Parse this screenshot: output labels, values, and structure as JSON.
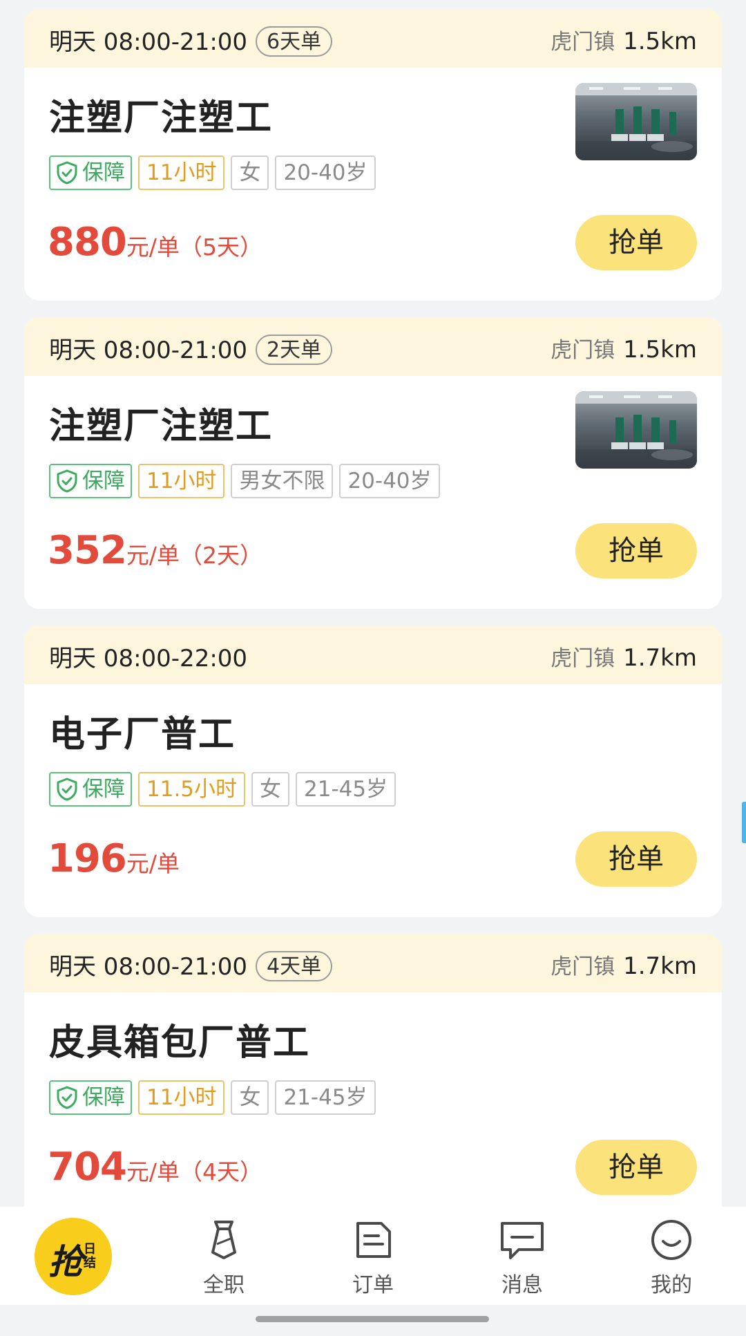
{
  "jobs": [
    {
      "time": "明天 08:00-21:00",
      "days_badge": "6天单",
      "location": "虎门镇",
      "distance": "1.5km",
      "title": "注塑厂注塑工",
      "has_thumb": true,
      "guarantee": "保障",
      "hours": "11小时",
      "gender": "女",
      "age": "20-40岁",
      "price": "880",
      "price_unit": "元/单（5天）",
      "button": "抢单"
    },
    {
      "time": "明天 08:00-21:00",
      "days_badge": "2天单",
      "location": "虎门镇",
      "distance": "1.5km",
      "title": "注塑厂注塑工",
      "has_thumb": true,
      "guarantee": "保障",
      "hours": "11小时",
      "gender": "男女不限",
      "age": "20-40岁",
      "price": "352",
      "price_unit": "元/单（2天）",
      "button": "抢单"
    },
    {
      "time": "明天 08:00-22:00",
      "days_badge": "",
      "location": "虎门镇",
      "distance": "1.7km",
      "title": "电子厂普工",
      "has_thumb": false,
      "guarantee": "保障",
      "hours": "11.5小时",
      "gender": "女",
      "age": "21-45岁",
      "price": "196",
      "price_unit": "元/单",
      "button": "抢单"
    },
    {
      "time": "明天 08:00-21:00",
      "days_badge": "4天单",
      "location": "虎门镇",
      "distance": "1.7km",
      "title": "皮具箱包厂普工",
      "has_thumb": false,
      "guarantee": "保障",
      "hours": "11小时",
      "gender": "女",
      "age": "21-45岁",
      "price": "704",
      "price_unit": "元/单（4天）",
      "button": "抢单"
    }
  ],
  "tabbar": {
    "grab": {
      "main": "抢",
      "sub": "日结",
      "icon": "grab-daily-icon"
    },
    "items": [
      {
        "label": "全职",
        "icon": "tie-icon"
      },
      {
        "label": "订单",
        "icon": "document-icon"
      },
      {
        "label": "消息",
        "icon": "message-icon"
      },
      {
        "label": "我的",
        "icon": "smiley-icon"
      }
    ]
  },
  "colors": {
    "accent_yellow": "#fbe27a",
    "header_bg": "#fdf6dc",
    "price_red": "#e24a3b",
    "guarantee_green": "#3bab5d",
    "hours_orange": "#e39b1c"
  }
}
